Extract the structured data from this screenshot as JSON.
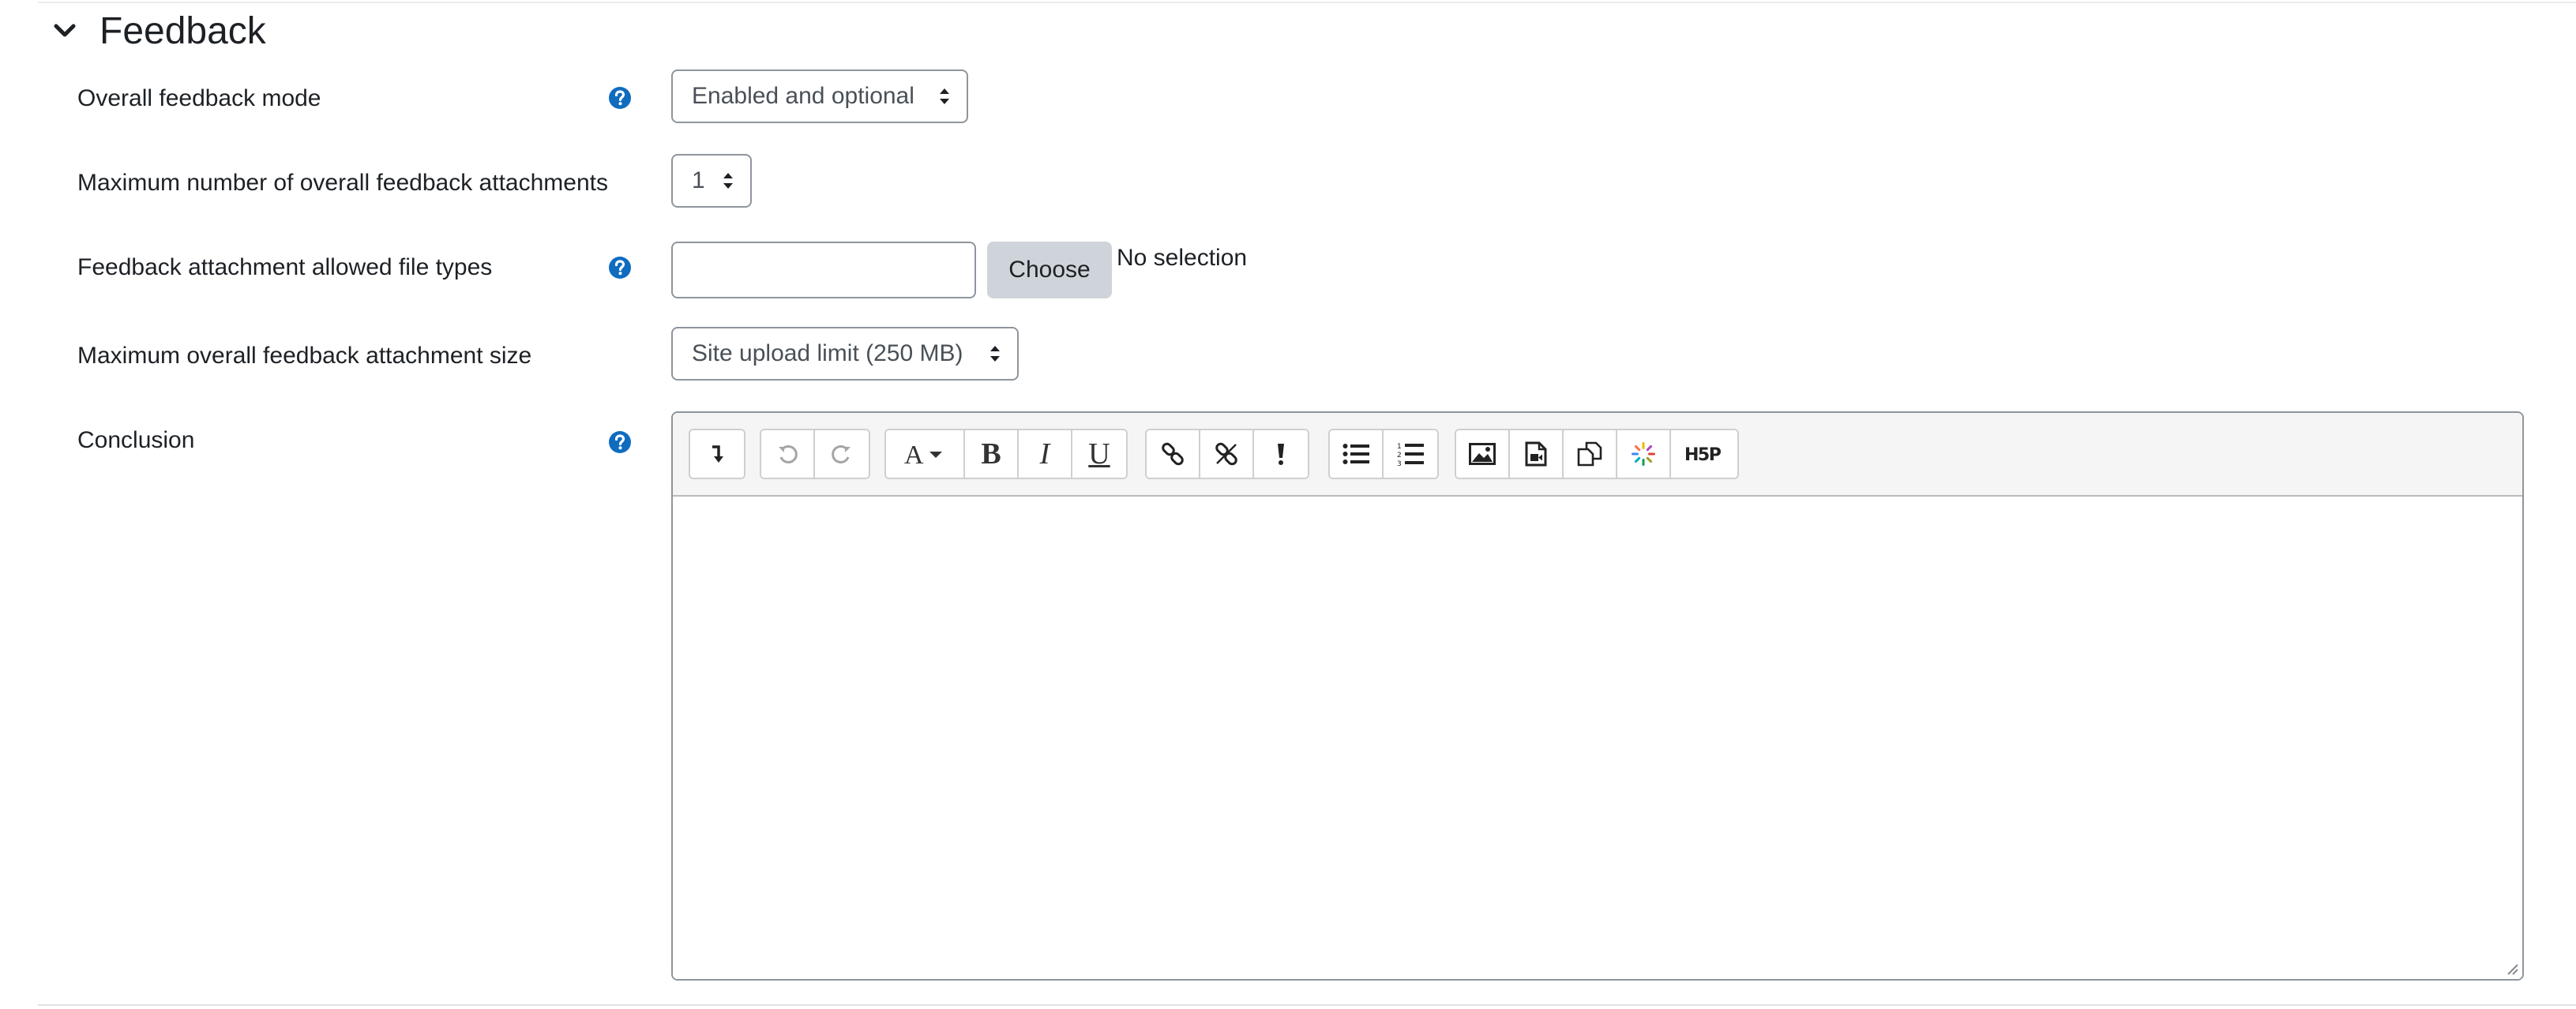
{
  "section": {
    "title": "Feedback",
    "expanded": true,
    "icon": "chevron-down-icon"
  },
  "rows": {
    "feedback_mode": {
      "label": "Overall feedback mode",
      "value": "Enabled and optional",
      "help": true
    },
    "max_attachments": {
      "label": "Maximum number of overall feedback attachments",
      "value": "1",
      "help": false
    },
    "file_types": {
      "label": "Feedback attachment allowed file types",
      "value": "",
      "choose_label": "Choose",
      "selection_text": "No selection",
      "help": true
    },
    "max_size": {
      "label": "Maximum overall feedback attachment size",
      "value": "Site upload limit (250 MB)",
      "help": false
    },
    "conclusion": {
      "label": "Conclusion",
      "help": true,
      "content": ""
    }
  },
  "editor_toolbar": {
    "groups": [
      [
        "show-more-buttons-icon"
      ],
      [
        "undo-icon",
        "redo-icon"
      ],
      [
        "font-style-icon",
        "bold-icon",
        "italic-icon",
        "underline-icon"
      ],
      [
        "link-icon",
        "unlink-icon",
        "accessibility-checker-icon"
      ],
      [
        "unordered-list-icon",
        "ordered-list-icon"
      ],
      [
        "insert-image-icon",
        "insert-media-icon",
        "manage-files-icon",
        "recordrtc-icon",
        "h5p-icon"
      ]
    ]
  },
  "colors": {
    "help_icon": "#0f6cbf",
    "text": "#1d2125",
    "border": "#8f959e",
    "button_bg": "#ced4da",
    "toolbar_bg": "#f5f5f5"
  }
}
